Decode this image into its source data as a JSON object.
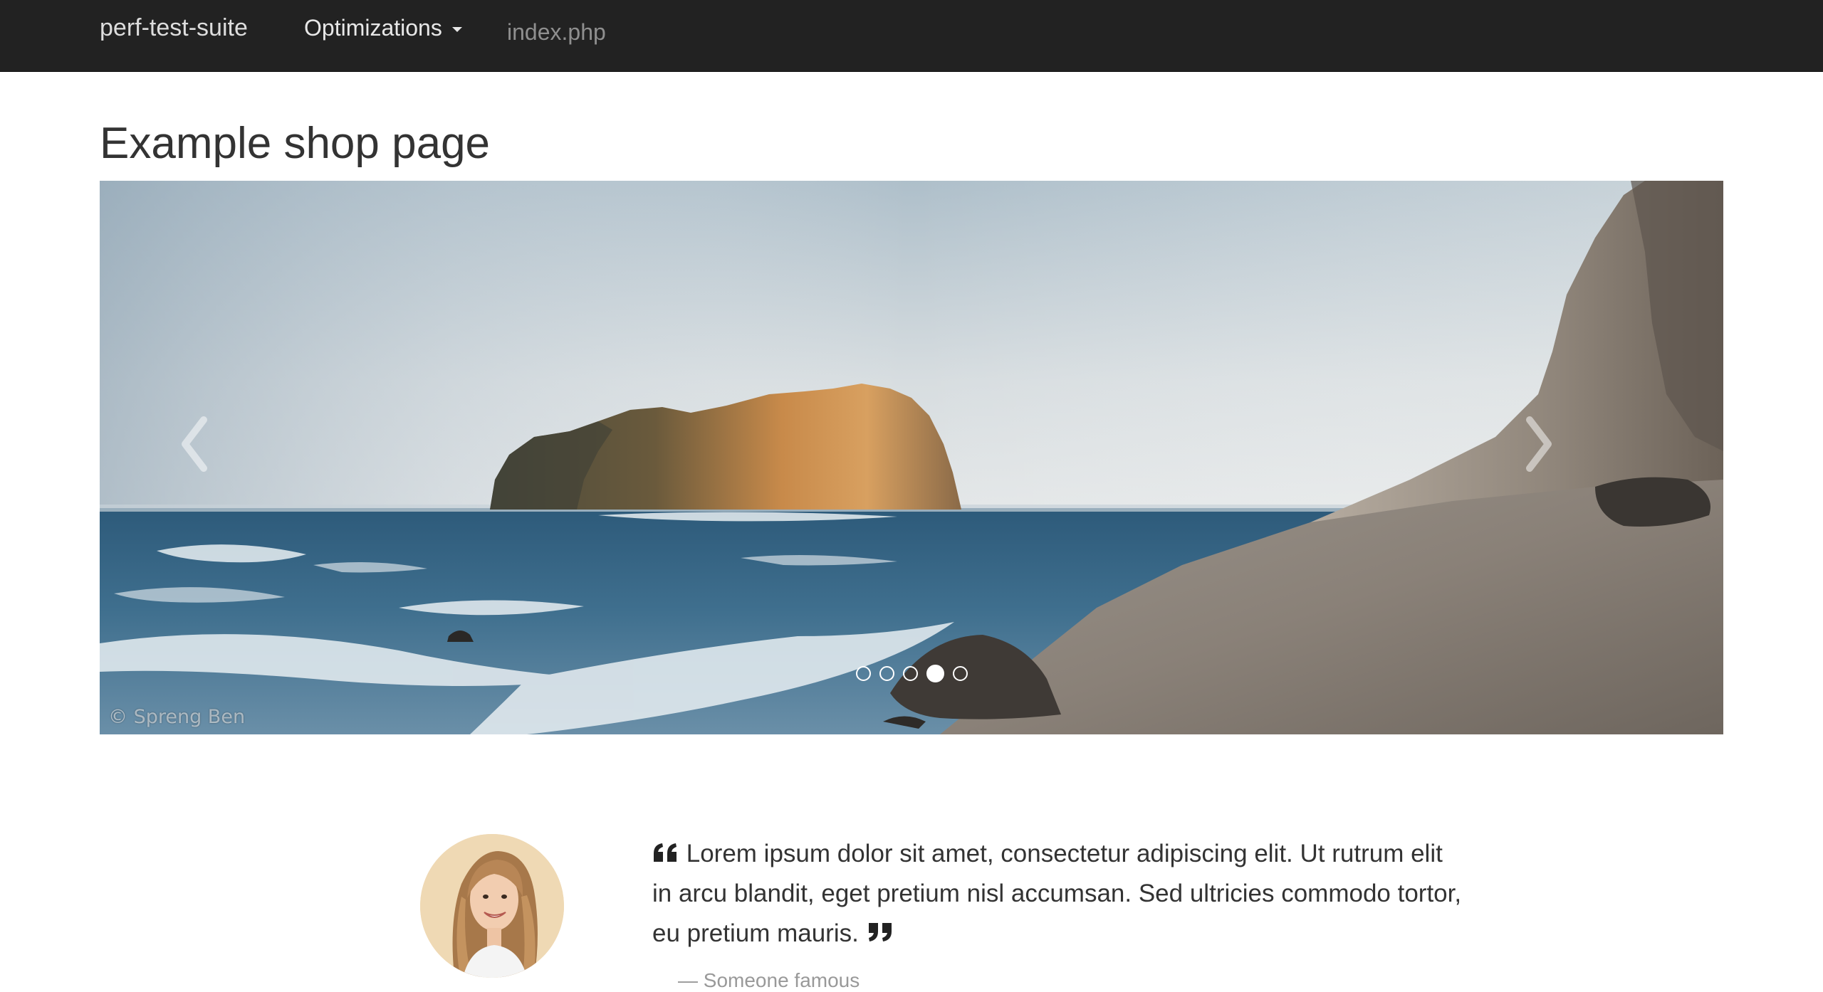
{
  "navbar": {
    "brand": "perf-test-suite",
    "dropdown_label": "Optimizations",
    "current_page": "index.php"
  },
  "page": {
    "title": "Example shop page"
  },
  "carousel": {
    "prev_label": "‹",
    "next_label": "›",
    "credit": "© Spreng Ben",
    "slide_count": 5,
    "active_index": 3,
    "indicators": [
      "slide-1",
      "slide-2",
      "slide-3",
      "slide-4",
      "slide-5"
    ]
  },
  "testimonial": {
    "quote": "Lorem ipsum dolor sit amet, consectetur adipiscing elit. Ut rutrum elit in arcu blandit, eget pretium nisl accumsan. Sed ultricies commodo tortor, eu pretium mauris.",
    "author": "— Someone famous"
  },
  "icons": {
    "open_quote": "quote-left-icon",
    "close_quote": "quote-right-icon",
    "dropdown": "caret-down-icon",
    "prev": "chevron-left-icon",
    "next": "chevron-right-icon"
  },
  "colors": {
    "navbar_bg": "#222222",
    "brand_text": "#dddddd",
    "muted_nav_text": "#8f8f8f",
    "body_text": "#333333",
    "author_text": "#999999"
  }
}
